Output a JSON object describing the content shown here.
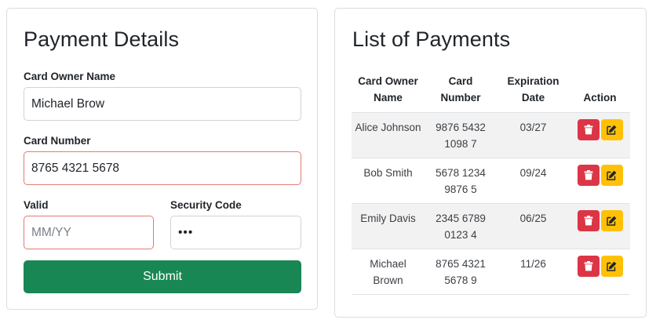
{
  "payment_form": {
    "title": "Payment Details",
    "owner_label": "Card Owner Name",
    "owner_value": "Michael Brow",
    "number_label": "Card Number",
    "number_value": "8765 4321 5678",
    "valid_label": "Valid",
    "valid_placeholder": "MM/YY",
    "security_label": "Security Code",
    "security_value": "•••",
    "submit_label": "Submit"
  },
  "payment_list": {
    "title": "List of Payments",
    "columns": [
      "Card Owner Name",
      "Card Number",
      "Expiration Date",
      "Action"
    ],
    "rows": [
      {
        "name": "Alice Johnson",
        "number": "9876 5432 1098 7",
        "expiration": "03/27"
      },
      {
        "name": "Bob Smith",
        "number": "5678 1234 9876 5",
        "expiration": "09/24"
      },
      {
        "name": "Emily Davis",
        "number": "2345 6789 0123 4",
        "expiration": "06/25"
      },
      {
        "name": "Michael Brown",
        "number": "8765 4321 5678 9",
        "expiration": "11/26"
      }
    ],
    "delete_icon": "trash-icon",
    "edit_icon": "pencil-square-icon"
  },
  "colors": {
    "submit": "#198754",
    "delete": "#dc3545",
    "edit": "#ffc107",
    "invalid_border": "#e57a73",
    "stripe": "#f2f2f2"
  }
}
